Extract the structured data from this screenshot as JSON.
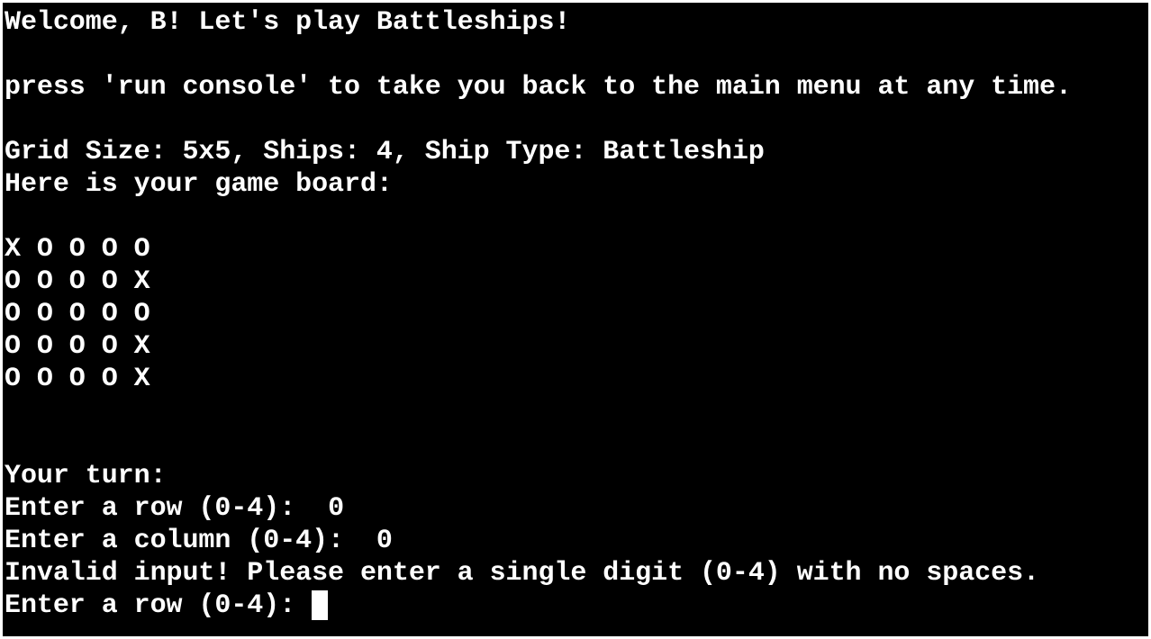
{
  "terminal": {
    "background": "#000000",
    "foreground": "#ffffff",
    "welcome": "Welcome, B! Let's play Battleships!",
    "menu_hint": "press 'run console' to take you back to the main menu at any time.",
    "settings": "Grid Size: 5x5, Ships: 4, Ship Type: Battleship",
    "board_heading": "Here is your game board:",
    "board_rows": [
      "X O O O O",
      "O O O O X",
      "O O O O O",
      "O O O O X",
      "O O O O X"
    ],
    "turn_label": "Your turn:",
    "row_prompt_1": "Enter a row (0-4):  ",
    "row_value_1": "0",
    "col_prompt_1": "Enter a column (0-4):  ",
    "col_value_1": "0",
    "error_message": "Invalid input! Please enter a single digit (0-4) with no spaces.",
    "row_prompt_2": "Enter a row (0-4): ",
    "cursor": "block-cursor"
  }
}
